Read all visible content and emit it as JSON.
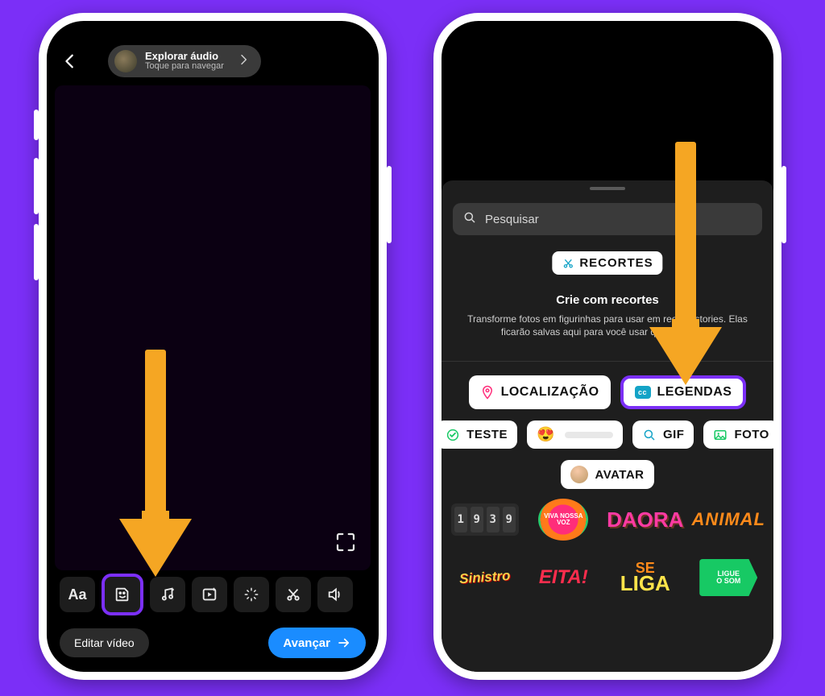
{
  "left": {
    "audio_pill": {
      "title": "Explorar áudio",
      "subtitle": "Toque para navegar"
    },
    "tools": [
      "Aa",
      "sticker",
      "music",
      "clip",
      "effects",
      "cut",
      "volume"
    ],
    "edit_label": "Editar vídeo",
    "next_label": "Avançar"
  },
  "right": {
    "search_placeholder": "Pesquisar",
    "recortes_label": "RECORTES",
    "recortes_title": "Crie com recortes",
    "recortes_desc": "Transforme fotos em figurinhas para usar em reels e stories. Elas ficarão salvas aqui para você usar quando quiser.",
    "chips": {
      "localizacao": "LOCALIZAÇÃO",
      "legendas": "LEGENDAS",
      "teste": "TESTE",
      "gif": "GIF",
      "foto": "FOTO",
      "avatar": "AVATAR",
      "cc": "cc"
    },
    "stickers": {
      "clock": [
        "1",
        "9",
        "3",
        "9"
      ],
      "viva": "VIVA NOSSA VOZ",
      "daora": "DAORA",
      "animal": "ANIMAL",
      "sinistro": "Sinistro",
      "eita": "EITA!",
      "seliga_top": "SE",
      "seliga_bot": "LIGA",
      "ligue1": "LIGUE",
      "ligue2": "O SOM"
    }
  },
  "colors": {
    "accent": "#7b2ff7",
    "arrow": "#f5a623",
    "next": "#1a8cff"
  }
}
